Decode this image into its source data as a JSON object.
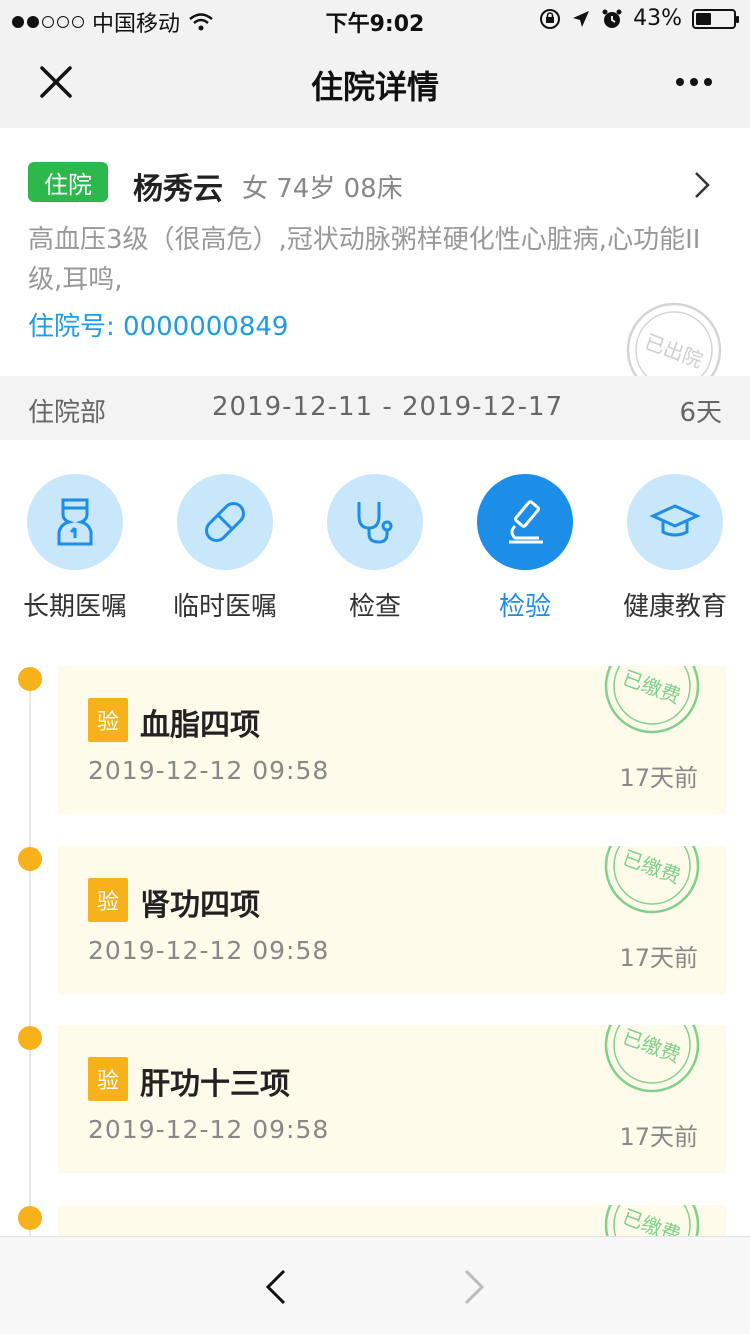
{
  "status": {
    "carrier": "中国移动",
    "time": "下午9:02",
    "battery_text": "43%",
    "battery_level": 0.43
  },
  "nav": {
    "title": "住院详情"
  },
  "patient": {
    "tag": "住院",
    "name": "杨秀云",
    "info": "女 74岁 08床",
    "diagnosis": "高血压3级（很高危）,冠状动脉粥样硬化性心脏病,心功能II级,耳鸣,",
    "hospital_no": "住院号: 0000000849",
    "stamp": "已出院"
  },
  "dept": {
    "name": "住院部",
    "range": "2019-12-11 - 2019-12-17",
    "days": "6天"
  },
  "categories": [
    {
      "label": "长期医嘱",
      "icon": "long-term-order-icon",
      "active": false
    },
    {
      "label": "临时医嘱",
      "icon": "pill-icon",
      "active": false
    },
    {
      "label": "检查",
      "icon": "stethoscope-icon",
      "active": false
    },
    {
      "label": "检验",
      "icon": "microscope-icon",
      "active": true
    },
    {
      "label": "健康教育",
      "icon": "graduation-cap-icon",
      "active": false
    }
  ],
  "items": [
    {
      "badge": "验",
      "name": "血脂四项",
      "time": "2019-12-12 09:58",
      "ago": "17天前",
      "stamp": "已缴费"
    },
    {
      "badge": "验",
      "name": "肾功四项",
      "time": "2019-12-12 09:58",
      "ago": "17天前",
      "stamp": "已缴费"
    },
    {
      "badge": "验",
      "name": "肝功十三项",
      "time": "2019-12-12 09:58",
      "ago": "17天前",
      "stamp": "已缴费"
    },
    {
      "badge": "",
      "name": "",
      "time": "",
      "ago": "",
      "stamp": "已缴费"
    }
  ],
  "colors": {
    "accent_blue": "#1d8ee8",
    "tag_green": "#2db84d",
    "badge_yellow": "#f7b21b",
    "stamp_green": "#7fd08a"
  }
}
